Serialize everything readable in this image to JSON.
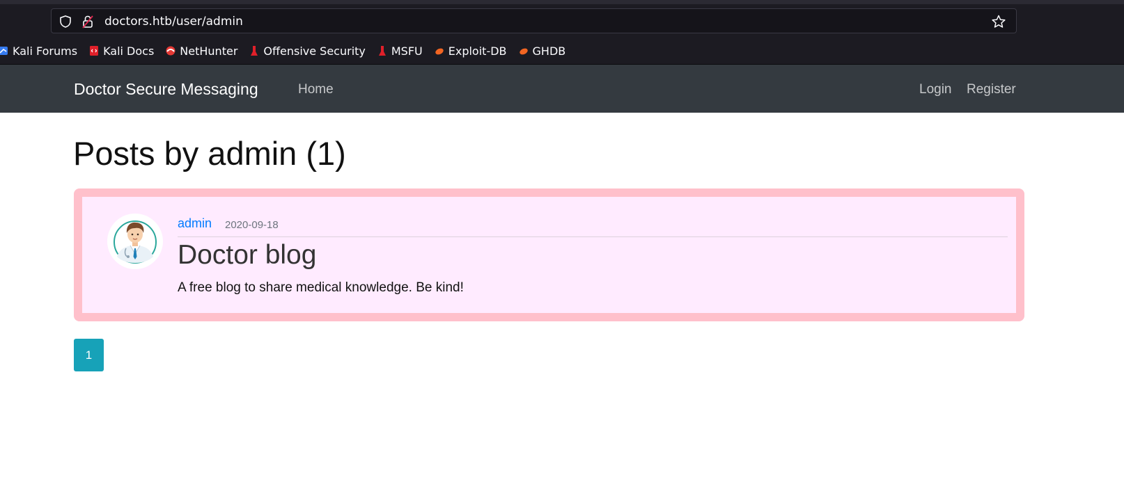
{
  "browser": {
    "url": "doctors.htb/user/admin",
    "bookmarks": [
      {
        "label": "Kali Forums",
        "icon": "kali-forums-icon",
        "color": "#367bf0"
      },
      {
        "label": "Kali Docs",
        "icon": "kali-docs-icon",
        "color": "#e0202a"
      },
      {
        "label": "NetHunter",
        "icon": "nethunter-icon",
        "color": "#e53935"
      },
      {
        "label": "Offensive Security",
        "icon": "offsec-icon",
        "color": "#e0202a"
      },
      {
        "label": "MSFU",
        "icon": "msfu-icon",
        "color": "#e0202a"
      },
      {
        "label": "Exploit-DB",
        "icon": "exploit-db-icon",
        "color": "#f26522"
      },
      {
        "label": "GHDB",
        "icon": "ghdb-icon",
        "color": "#f26522"
      }
    ]
  },
  "navbar": {
    "brand": "Doctor Secure Messaging",
    "home": "Home",
    "login": "Login",
    "register": "Register"
  },
  "main": {
    "title": "Posts by admin (1)",
    "posts": [
      {
        "author": "admin",
        "date": "2020-09-18",
        "title": "Doctor blog",
        "body": "A free blog to share medical knowledge. Be kind!"
      }
    ],
    "pagination": {
      "current": "1"
    }
  },
  "colors": {
    "navbar_bg": "#343a40",
    "card_bg": "#ffebff",
    "card_border": "#ffc0cb",
    "link": "#007bff",
    "page_button": "#17a2b8"
  }
}
